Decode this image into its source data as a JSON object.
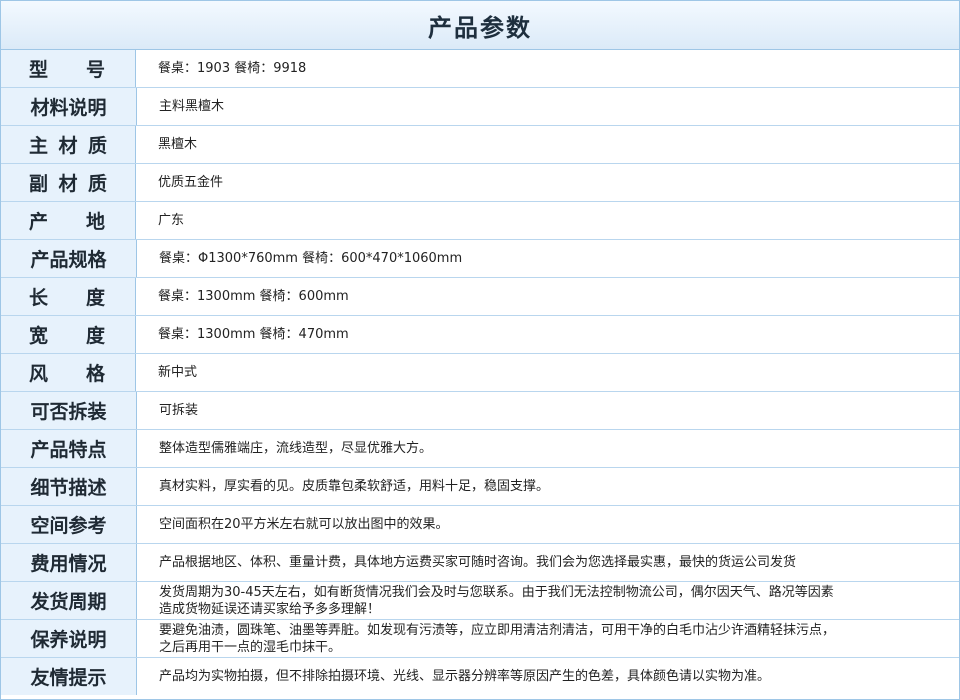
{
  "title": "产品参数",
  "rows": [
    {
      "label_chars": [
        "型",
        "号"
      ],
      "value": "餐桌：1903   餐椅：9918"
    },
    {
      "label": "材料说明",
      "value": "主料黑檀木"
    },
    {
      "label_chars": [
        "主",
        "材",
        "质"
      ],
      "value": "黑檀木"
    },
    {
      "label_chars": [
        "副",
        "材",
        "质"
      ],
      "value": "优质五金件"
    },
    {
      "label_chars": [
        "产",
        "地"
      ],
      "value": "广东"
    },
    {
      "label": "产品规格",
      "value": "餐桌：Φ1300*760mm    餐椅：600*470*1060mm"
    },
    {
      "label_chars": [
        "长",
        "度"
      ],
      "value": "餐桌：1300mm   餐椅：600mm"
    },
    {
      "label_chars": [
        "宽",
        "度"
      ],
      "value": "餐桌：1300mm   餐椅：470mm"
    },
    {
      "label_chars": [
        "风",
        "格"
      ],
      "value": "新中式"
    },
    {
      "label": "可否拆装",
      "value": "可拆装"
    },
    {
      "label": "产品特点",
      "value": "整体造型儒雅端庄，流线造型，尽显优雅大方。"
    },
    {
      "label": "细节描述",
      "value": "真材实料，厚实看的见。皮质靠包柔软舒适，用料十足，稳固支撑。"
    },
    {
      "label": "空间参考",
      "value": "空间面积在20平方米左右就可以放出图中的效果。"
    },
    {
      "label": "费用情况",
      "value": "产品根据地区、体积、重量计费，具体地方运费买家可随时咨询。我们会为您选择最实惠，最快的货运公司发货"
    },
    {
      "label": "发货周期",
      "value_lines": [
        "发货周期为30-45天左右，如有断货情况我们会及时与您联系。由于我们无法控制物流公司，偶尔因天气、路况等因素",
        "造成货物延误还请买家给予多多理解！"
      ]
    },
    {
      "label": "保养说明",
      "value_lines": [
        "要避免油渍，圆珠笔、油墨等弄脏。如发现有污渍等，应立即用清洁剂清洁，可用干净的白毛巾沾少许酒精轻抹污点，",
        "之后再用干一点的湿毛巾抹干。"
      ]
    },
    {
      "label": "友情提示",
      "value": "产品均为实物拍摄，但不排除拍摄环境、光线、显示器分辨率等原因产生的色差，具体颜色请以实物为准。"
    }
  ]
}
